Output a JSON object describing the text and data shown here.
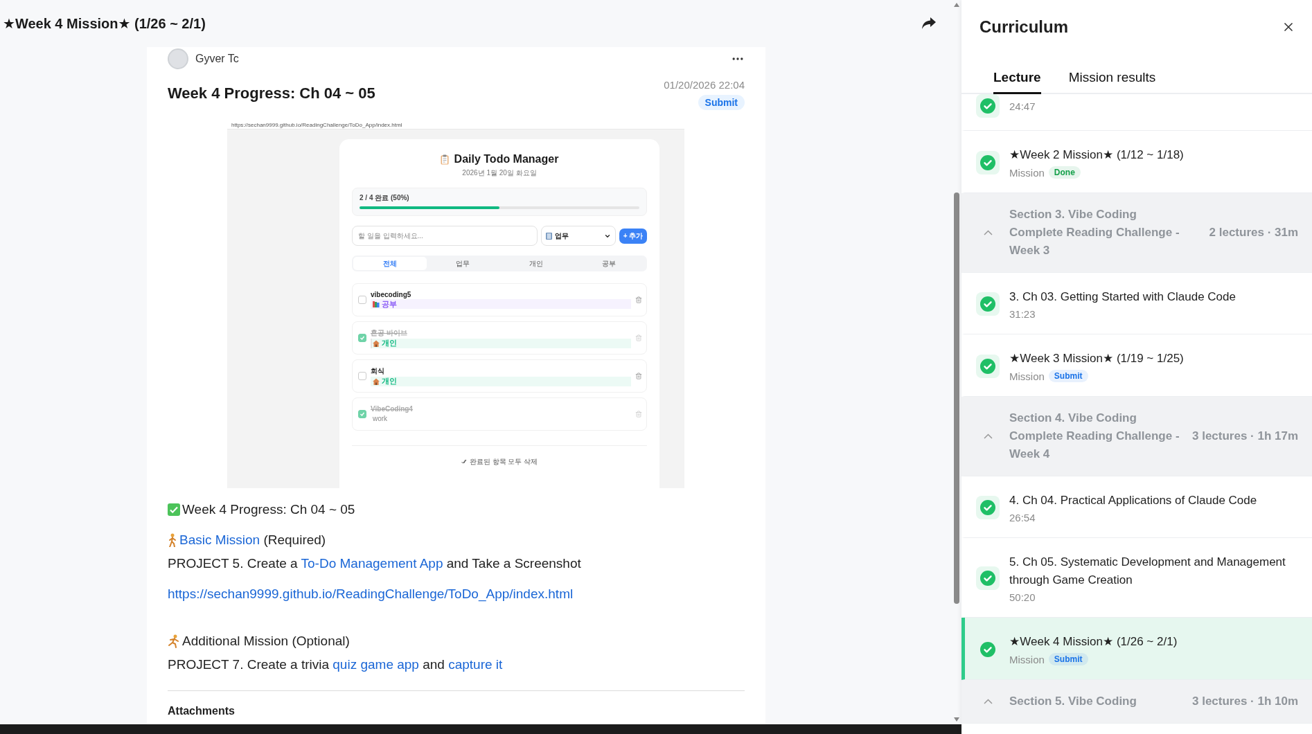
{
  "header": {
    "title": "★Week 4 Mission★ (1/26 ~ 2/1)"
  },
  "post": {
    "author": "Gyver Tc",
    "title": "Week 4 Progress: Ch 04 ~ 05",
    "date": "01/20/2026 22:04",
    "status": "Submit",
    "screenshot": {
      "url": "https://sechan9999.github.io/ReadingChallenge/ToDo_App/index.html",
      "app_title": "Daily Todo Manager",
      "date": "2026년 1월 20일 화요일",
      "progress_text": "2 / 4 완료 (50%)",
      "level": 0.5,
      "input_placeholder": "할 일을 입력하세요...",
      "category": "업무",
      "add_button": "+ 추가",
      "filters": [
        {
          "label": "전체",
          "selected": true
        },
        {
          "label": "업무",
          "selected": false
        },
        {
          "label": "개인",
          "selected": false
        },
        {
          "label": "공부",
          "selected": false
        }
      ],
      "todos": [
        {
          "text": "vibecoding5",
          "checked": false,
          "kind": "study",
          "tag": "공부",
          "color": "#8b5cf6"
        },
        {
          "text": "혼공 바이브",
          "checked": true,
          "kind": "personal",
          "tag": "개인",
          "color": "#10b981"
        },
        {
          "text": "회식",
          "checked": false,
          "kind": "personal",
          "tag": "개인",
          "color": "#10b981"
        },
        {
          "text": "VibeCoding4",
          "checked": true,
          "kind": "plain",
          "tag": "work"
        }
      ],
      "clear_button": "완료된 항목 모두 삭제"
    },
    "body": [
      {
        "kind": "check",
        "segments": [
          {
            "text": "Week 4 Progress: Ch 04 ~ 05",
            "link": false
          }
        ]
      },
      {
        "kind": "walker",
        "segments": [
          {
            "text": "Basic Mission",
            "link": true
          },
          {
            "text": " (Required)",
            "link": false
          }
        ]
      },
      {
        "kind": "text",
        "segments": [
          {
            "text": "PROJECT 5. Create a ",
            "link": false
          },
          {
            "text": "To-Do Management App",
            "link": true
          },
          {
            "text": " and Take a Screenshot",
            "link": false
          }
        ]
      },
      {
        "kind": "url",
        "segments": [
          {
            "text": "https://sechan9999.github.io/ReadingChallenge/ToDo_App/index.html",
            "link": true
          }
        ]
      },
      {
        "kind": "runner",
        "segments": [
          {
            "text": "Additional Mission (Optional)",
            "link": false
          }
        ]
      },
      {
        "kind": "text",
        "segments": [
          {
            "text": "PROJECT 7. Create a trivia ",
            "link": false
          },
          {
            "text": "quiz game app",
            "link": true
          },
          {
            "text": " and ",
            "link": false
          },
          {
            "text": "capture it",
            "link": true
          }
        ]
      }
    ],
    "attachments_label": "Attachments"
  },
  "curriculum": {
    "title": "Curriculum",
    "tabs": [
      {
        "label": "Lecture",
        "selected": true
      },
      {
        "label": "Mission results",
        "selected": false
      }
    ],
    "items": [
      {
        "kind": "lecture",
        "duration": "24:47",
        "done": true,
        "selected": false
      },
      {
        "kind": "mission",
        "title": "★Week 2 Mission★ (1/12 ~ 1/18)",
        "type_label": "Mission",
        "badge": "Done",
        "color": "#15a04a",
        "done": true,
        "selected": false
      },
      {
        "kind": "section",
        "title": "Section 3. Vibe Coding Complete Reading Challenge - Week 3",
        "meta": "2 lectures · 31m",
        "expanded": true
      },
      {
        "kind": "lecture",
        "title": "3. Ch 03. Getting Started with Claude Code",
        "duration": "31:23",
        "done": true,
        "selected": false
      },
      {
        "kind": "mission",
        "title": "★Week 3 Mission★ (1/19 ~ 1/25)",
        "type_label": "Mission",
        "badge": "Submit",
        "color": "#1a73e8",
        "done": true,
        "selected": false
      },
      {
        "kind": "section",
        "title": "Section 4. Vibe Coding Complete Reading Challenge - Week 4",
        "meta": "3 lectures · 1h 17m",
        "expanded": true
      },
      {
        "kind": "lecture",
        "title": "4. Ch 04. Practical Applications of Claude Code",
        "duration": "26:54",
        "done": true,
        "selected": false
      },
      {
        "kind": "lecture",
        "title": "5. Ch 05. Systematic Development and Management through Game Creation",
        "duration": "50:20",
        "done": true,
        "selected": false
      },
      {
        "kind": "mission",
        "title": "★Week 4 Mission★ (1/26 ~ 2/1)",
        "type_label": "Mission",
        "badge": "Submit",
        "color": "#1a73e8",
        "done": true,
        "selected": true
      },
      {
        "kind": "section",
        "title": "Section 5. Vibe Coding",
        "meta": "3 lectures · 1h 10m",
        "expanded": true
      }
    ]
  }
}
